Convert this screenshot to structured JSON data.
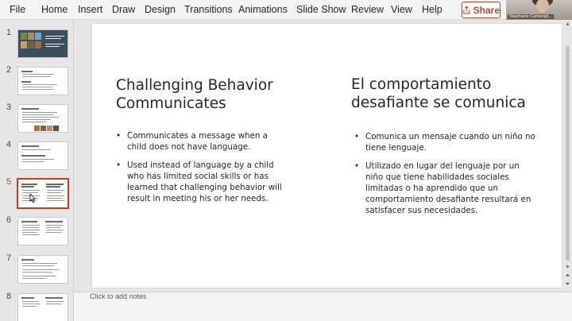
{
  "menu": {
    "items": [
      "File",
      "Home",
      "Insert",
      "Draw",
      "Design",
      "Transitions",
      "Animations",
      "Slide Show",
      "Review",
      "View",
      "Help"
    ],
    "share_label": "Share"
  },
  "webcam": {
    "name": "Stephanie Cartwrigh..."
  },
  "thumbnails": {
    "numbers": [
      "1",
      "2",
      "3",
      "4",
      "5",
      "6",
      "7",
      "8"
    ],
    "active": "5"
  },
  "slide": {
    "left": {
      "title": "Challenging Behavior Communicates",
      "bullets": [
        "Communicates a message when a child does not have language.",
        "Used instead of language by a child who has limited social skills or has learned that challenging behavior will result in meeting his or her needs."
      ]
    },
    "right": {
      "title": "El comportamiento desafiante se comunica",
      "bullets": [
        "Comunica un mensaje cuando un niño no tiene lenguaje.",
        "Utilizado en lugar del lenguaje por un niño que tiene habilidades sociales limitadas o ha aprendido que un comportamiento desafiante resultará en satisfacer sus necesidades."
      ]
    }
  },
  "notes": {
    "placeholder": "Click to add notes"
  },
  "colors": {
    "accent": "#c43e1c",
    "share": "#b7472a"
  }
}
